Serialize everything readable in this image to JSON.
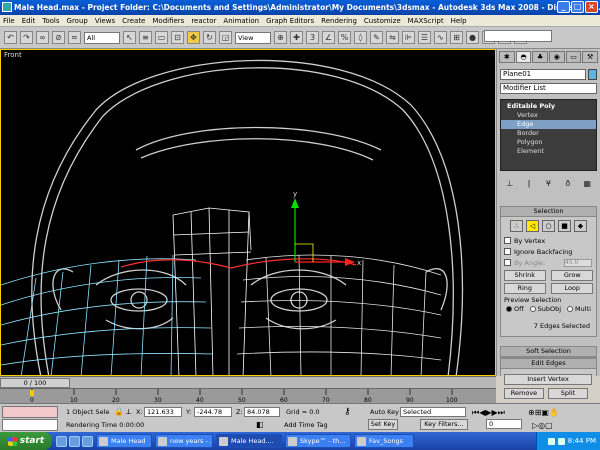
{
  "window": {
    "title": "Male Head.max   - Project Folder: C:\\Documents and Settings\\Administrator\\My Documents\\3dsmax   - Autodesk 3ds Max 2008   - Display : Di...",
    "minimize": "_",
    "maximize": "□",
    "close": "×"
  },
  "menu": [
    "File",
    "Edit",
    "Tools",
    "Group",
    "Views",
    "Create",
    "Modifiers",
    "reactor",
    "Animation",
    "Graph Editors",
    "Rendering",
    "Customize",
    "MAXScript",
    "Help"
  ],
  "toolbar": {
    "filter": "All",
    "refcoord": "View"
  },
  "viewport": {
    "label": "Front",
    "gizmo": {
      "y": "y",
      "x": "x"
    }
  },
  "command_panel": {
    "object_name": "Plane01",
    "object_color": "#5ab4e8",
    "modifier_list": "Modifier List",
    "stack": {
      "top": "Editable Poly",
      "items": [
        "Vertex",
        "Edge",
        "Border",
        "Polygon",
        "Element"
      ],
      "selected": "Edge"
    },
    "selection": {
      "title": "Selection",
      "by_vertex": "By Vertex",
      "ignore_backfacing": "Ignore Backfacing",
      "by_angle": "By Angle:",
      "by_angle_value": "45.0",
      "shrink": "Shrink",
      "grow": "Grow",
      "ring": "Ring",
      "loop": "Loop",
      "preview": "Preview Selection",
      "preview_off": "Off",
      "preview_subobj": "SubObj",
      "preview_multi": "Multi",
      "status": "7 Edges Selected"
    },
    "soft_selection": "Soft Selection",
    "edit_edges": "Edit Edges",
    "insert_vertex": "Insert Vertex",
    "remove": "Remove",
    "split": "Split"
  },
  "timeline": {
    "frame": "0 / 100",
    "ticks": [
      "0",
      "10",
      "20",
      "30",
      "40",
      "50",
      "60",
      "70",
      "80",
      "90",
      "100"
    ]
  },
  "status": {
    "selection": "1 Object Sele",
    "x_label": "X:",
    "x": "121.633",
    "y_label": "Y:",
    "y": "-244.78",
    "z_label": "Z:",
    "z": "84.078",
    "grid": "Grid = 0.0",
    "auto_key": "Auto Key",
    "key_mode": "Selected",
    "set_key": "Set Key",
    "key_filters": "Key Filters...",
    "rendering_time": "Rendering Time  0:00:00",
    "add_time_tag": "Add Time Tag",
    "frame_field": "0"
  },
  "taskbar": {
    "start": "start",
    "tasks": [
      "Male Head",
      "new years - ...",
      "Male Head....",
      "Skype™ - th...",
      "Fav_Songs"
    ],
    "active_index": 2,
    "clock": "8:44 PM"
  }
}
